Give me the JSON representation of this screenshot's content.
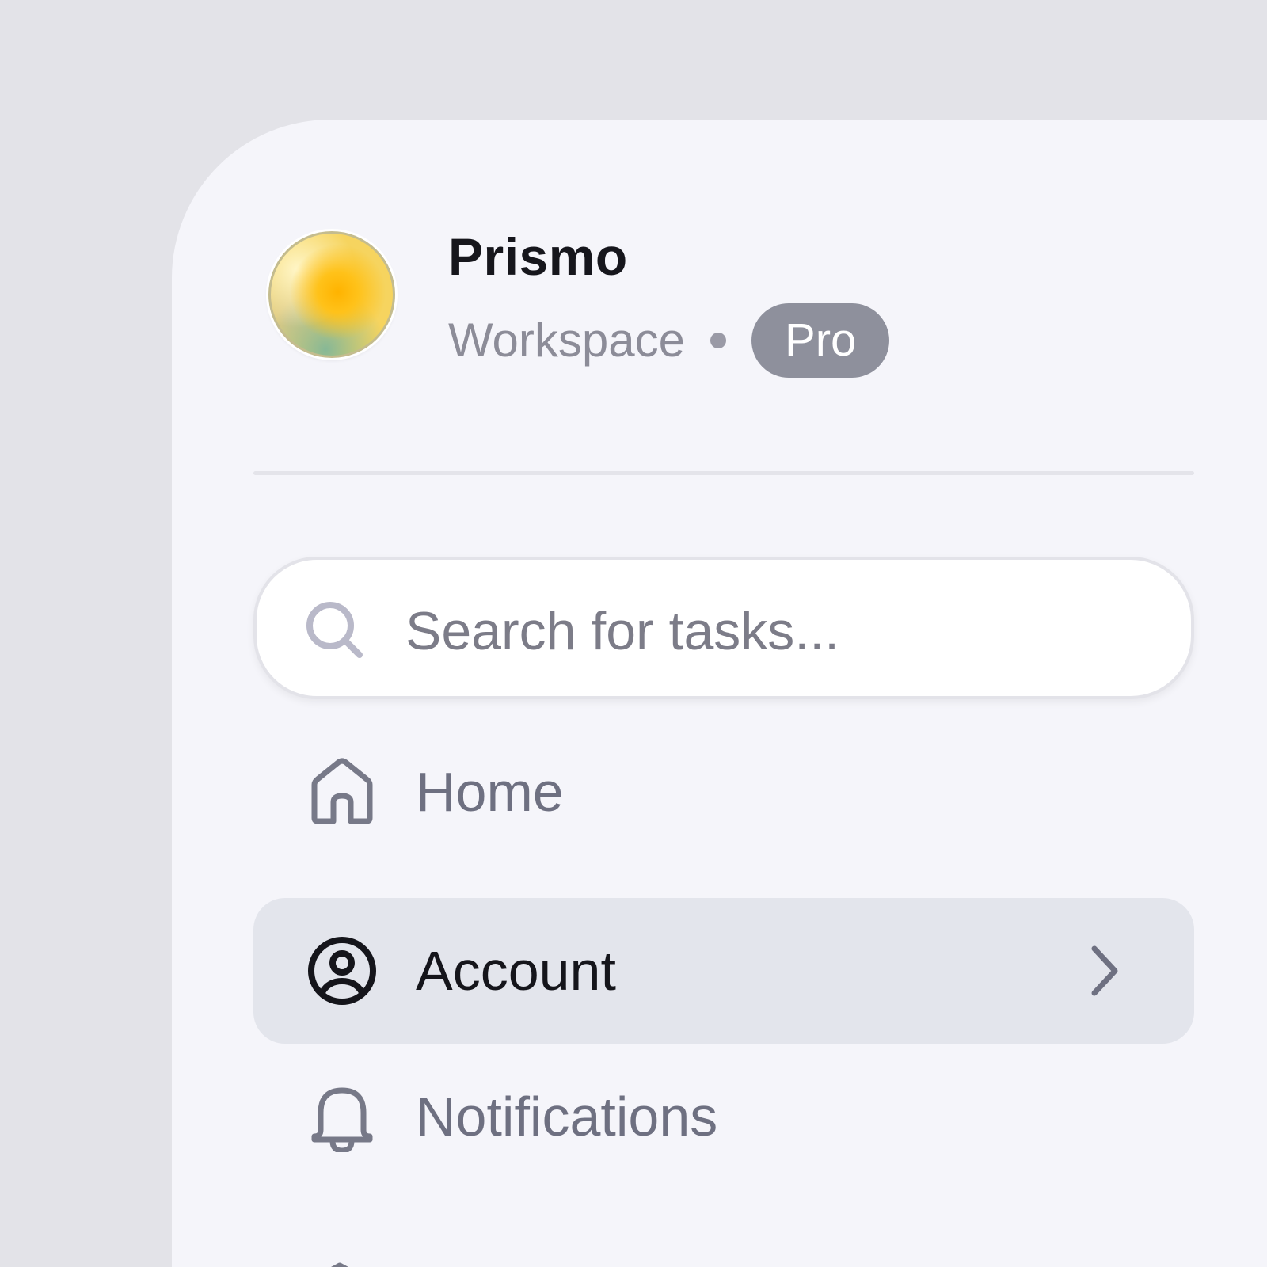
{
  "workspace": {
    "name": "Prismo",
    "subtitle": "Workspace",
    "plan_badge": "Pro"
  },
  "search": {
    "placeholder": "Search for tasks..."
  },
  "nav": {
    "items": [
      {
        "label": "Home",
        "icon": "home-icon",
        "active": false
      },
      {
        "label": "Account",
        "icon": "user-circle-icon",
        "active": true
      },
      {
        "label": "Notifications",
        "icon": "bell-icon",
        "active": false
      }
    ]
  },
  "colors": {
    "background": "#e3e3e8",
    "panel": "#f5f5fa",
    "active_item": "#e3e5ec",
    "badge": "#8e909c",
    "text_primary": "#15151b",
    "text_muted": "#6e7081"
  }
}
